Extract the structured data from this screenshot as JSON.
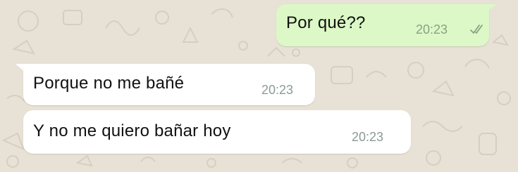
{
  "conversation": {
    "messages": [
      {
        "direction": "outgoing",
        "text": "Por qué??",
        "time": "20:23",
        "status_icon": "double-check-icon"
      },
      {
        "direction": "incoming",
        "text": "Porque no me bañé",
        "time": "20:23"
      },
      {
        "direction": "incoming",
        "text": "Y no me quiero bañar hoy",
        "time": "20:23"
      }
    ]
  },
  "colors": {
    "background": "#e8e1d6",
    "outgoing_bubble": "#dcf8c6",
    "incoming_bubble": "#ffffff",
    "timestamp": "#8c9a98"
  }
}
